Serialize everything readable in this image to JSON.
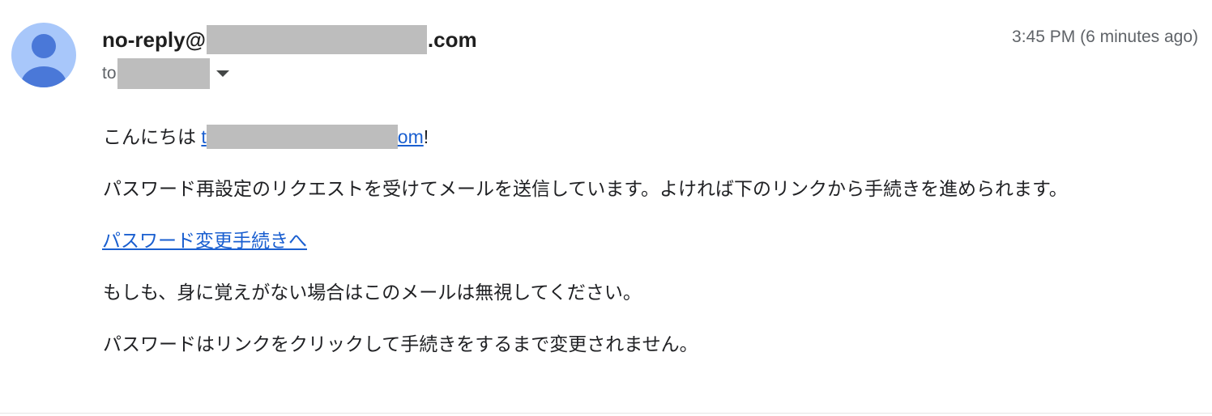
{
  "message": {
    "sender": {
      "prefix": "no-reply@",
      "suffix": ".com"
    },
    "timestamp": "3:45 PM (6 minutes ago)",
    "recipient_prefix": "to"
  },
  "body": {
    "greeting_prefix": "こんにちは ",
    "greeting_link_start": "t",
    "greeting_link_end": "om",
    "greeting_suffix": "!",
    "paragraph_1": "パスワード再設定のリクエストを受けてメールを送信しています。よければ下のリンクから手続きを進められます。",
    "change_password_link": "パスワード変更手続きへ",
    "paragraph_2": "もしも、身に覚えがない場合はこのメールは無視してください。",
    "paragraph_3": "パスワードはリンクをクリックして手続きをするまで変更されません。"
  },
  "icons": {
    "avatar": "default-person-avatar-icon",
    "recipient_details": "caret-down-icon"
  },
  "colors": {
    "avatar_background": "#a8c7fa",
    "avatar_figure": "#4a78d8",
    "link": "#1a5fd0",
    "redaction": "#bdbdbd"
  }
}
